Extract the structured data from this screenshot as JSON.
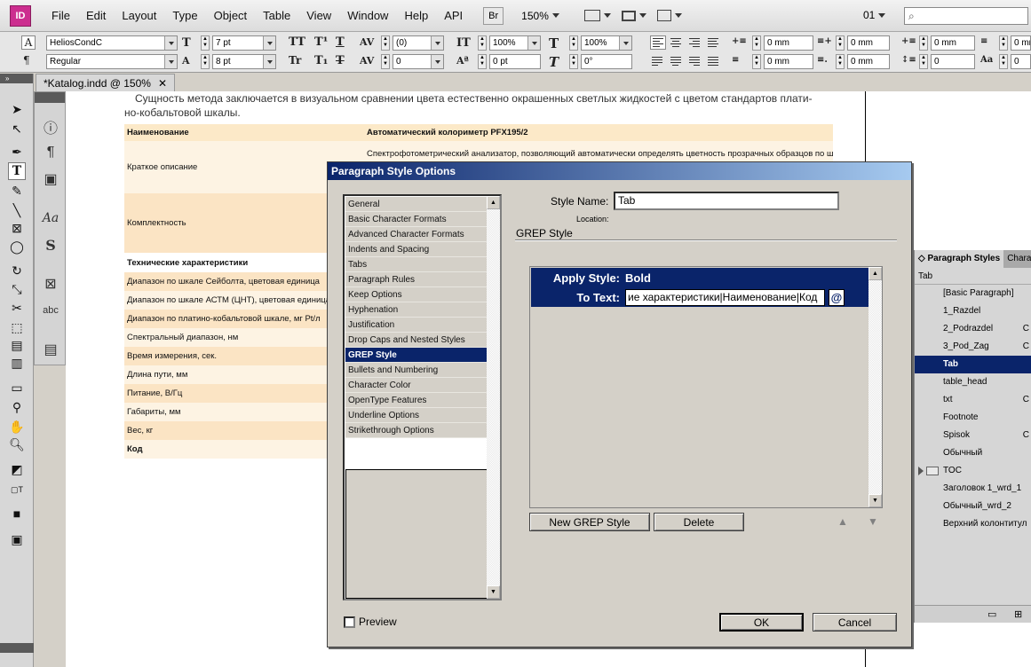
{
  "app": {
    "logo": "ID",
    "menu": [
      "File",
      "Edit",
      "Layout",
      "Type",
      "Object",
      "Table",
      "View",
      "Window",
      "Help",
      "API"
    ],
    "bridge": "Br",
    "zoom": "150%",
    "page_number": "01"
  },
  "control": {
    "font_family": "HeliosCondC",
    "font_style": "Regular",
    "font_size": "7 pt",
    "leading": "8 pt",
    "kerning": "(0)",
    "tracking": "0",
    "vscale": "100%",
    "hscale": "100%",
    "baseline": "0 pt",
    "skew": "0°",
    "indent_left": "0 mm",
    "indent_first": "0 mm",
    "indent_right": "0 mm",
    "indent_last": "0 mm",
    "space_before": "0 mm",
    "space_after": "0 mm",
    "dropcap_lines": "0",
    "dropcap_chars": "0"
  },
  "document": {
    "tab_title": "*Katalog.indd @ 150%",
    "intro_line1": "Сущность метода заключается в визуальном сравнении цвета естественно окрашенных светлых жидкостей с цветом стандартов плати-",
    "intro_line2": "но-кобальтовой шкалы.",
    "table": {
      "header": [
        "Наименование",
        "Автоматический колориметр PFX195/2"
      ],
      "rows": [
        {
          "label": "Краткое описание",
          "value": "Спектрофотометрический анализатор, позволяющий автоматически определять цветность прозрачных образцов по шка-"
        },
        {
          "label": "Комплектность",
          "value": ""
        },
        {
          "label": "Технические характеристики",
          "value": ""
        },
        {
          "label": "Диапазон по шкале Сейболта, цветовая единица",
          "value": ""
        },
        {
          "label": "Диапазон по шкале АСТМ (ЦНТ), цветовая единица",
          "value": ""
        },
        {
          "label": "Диапазон по платино-кобальтовой шкале, мг Pt/л",
          "value": ""
        },
        {
          "label": "Спектральный диапазон, нм",
          "value": ""
        },
        {
          "label": "Время измерения, сек.",
          "value": ""
        },
        {
          "label": "Длина пути, мм",
          "value": ""
        },
        {
          "label": "Питание, В/Гц",
          "value": ""
        },
        {
          "label": "Габариты, мм",
          "value": ""
        },
        {
          "label": "Вес, кг",
          "value": ""
        },
        {
          "label": "Код",
          "value": ""
        }
      ]
    }
  },
  "dialog": {
    "title": "Paragraph Style Options",
    "categories": [
      "General",
      "Basic Character Formats",
      "Advanced Character Formats",
      "Indents and Spacing",
      "Tabs",
      "Paragraph Rules",
      "Keep Options",
      "Hyphenation",
      "Justification",
      "Drop Caps and Nested Styles",
      "GREP Style",
      "Bullets and Numbering",
      "Character Color",
      "OpenType Features",
      "Underline Options",
      "Strikethrough Options"
    ],
    "selected_category": "GREP Style",
    "style_name_label": "Style Name:",
    "style_name_value": "Tab",
    "location_label": "Location:",
    "section_title": "GREP Style",
    "apply_style_label": "Apply Style:",
    "apply_style_value": "Bold",
    "to_text_label": "To Text:",
    "to_text_value": "ие характеристики|Наименование|Код",
    "at_symbol": "@",
    "new_grep_button": "New GREP Style",
    "delete_button": "Delete",
    "preview_label": "Preview",
    "ok_button": "OK",
    "cancel_button": "Cancel"
  },
  "styles_panel": {
    "tab_active": "Paragraph Styles",
    "tab_other": "Chara",
    "current": "Tab",
    "items": [
      {
        "name": "[Basic Paragraph]",
        "shortcut": ""
      },
      {
        "name": "1_Razdel",
        "shortcut": ""
      },
      {
        "name": "2_Podrazdel",
        "shortcut": "C"
      },
      {
        "name": "3_Pod_Zag",
        "shortcut": "C"
      },
      {
        "name": "Tab",
        "shortcut": ""
      },
      {
        "name": "table_head",
        "shortcut": ""
      },
      {
        "name": "txt",
        "shortcut": "C"
      },
      {
        "name": "Footnote",
        "shortcut": ""
      },
      {
        "name": "Spisok",
        "shortcut": "C"
      },
      {
        "name": "Обычный",
        "shortcut": ""
      },
      {
        "name": "TOC",
        "shortcut": ""
      },
      {
        "name": "Заголовок 1_wrd_1",
        "shortcut": ""
      },
      {
        "name": "Обычный_wrd_2",
        "shortcut": ""
      },
      {
        "name": "Верхний колонтитул",
        "shortcut": ""
      }
    ]
  }
}
